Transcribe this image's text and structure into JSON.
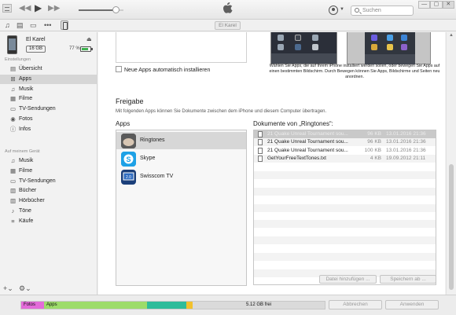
{
  "transport": {
    "prev": "◀◀",
    "play": "▶",
    "next": "▶▶",
    "volume": 0.85
  },
  "search": {
    "placeholder": "Suchen"
  },
  "window_controls": [
    "—",
    "▢",
    "✕"
  ],
  "toolbar": {
    "icons": [
      "music-note-icon",
      "film-icon",
      "tv-icon",
      "more-icon",
      "iphone-icon"
    ],
    "device_tab": "El Karel"
  },
  "device": {
    "name": "El Karel",
    "capacity": "16 GB",
    "battery_text": "77 %",
    "battery_level": 0.77
  },
  "sidebar": {
    "settings_header": "Einstellungen",
    "settings": [
      {
        "label": "Übersicht",
        "icon": "▤",
        "icon_name": "summary-icon"
      },
      {
        "label": "Apps",
        "icon": "⊞",
        "icon_name": "apps-icon"
      },
      {
        "label": "Musik",
        "icon": "♫",
        "icon_name": "music-icon"
      },
      {
        "label": "Filme",
        "icon": "▦",
        "icon_name": "film-icon"
      },
      {
        "label": "TV-Sendungen",
        "icon": "▭",
        "icon_name": "tv-icon"
      },
      {
        "label": "Fotos",
        "icon": "◉",
        "icon_name": "photos-icon"
      },
      {
        "label": "Infos",
        "icon": "ⓘ",
        "icon_name": "info-icon"
      }
    ],
    "device_header": "Auf meinem Gerät",
    "device_items": [
      {
        "label": "Musik",
        "icon": "♫",
        "icon_name": "music-icon"
      },
      {
        "label": "Filme",
        "icon": "▦",
        "icon_name": "film-icon"
      },
      {
        "label": "TV-Sendungen",
        "icon": "▭",
        "icon_name": "tv-icon"
      },
      {
        "label": "Bücher",
        "icon": "▥",
        "icon_name": "books-icon"
      },
      {
        "label": "Hörbücher",
        "icon": "▥",
        "icon_name": "audiobooks-icon"
      },
      {
        "label": "Töne",
        "icon": "♪",
        "icon_name": "tones-icon"
      },
      {
        "label": "Käufe",
        "icon": "≡",
        "icon_name": "purchases-icon"
      }
    ],
    "bottom": {
      "add": "+⌄",
      "settings": "⚙⌄"
    }
  },
  "main": {
    "auto_install_label": "Neue Apps automatisch installieren",
    "home_caption": "Wählen Sie Apps, die auf Ihrem iPhone installiert werden sollen, oder bewegen Sie Apps auf einen bestimmten Bildschirm. Durch Bewegen können Sie Apps, Bildschirme und Seiten neu anordnen.",
    "freigabe": {
      "title": "Freigabe",
      "description": "Mit folgenden Apps können Sie Dokumente zwischen dem iPhone und diesem Computer übertragen.",
      "apps_header": "Apps",
      "docs_header": "Dokumente von „Ringtones“:",
      "apps": [
        {
          "label": "Ringtones",
          "icon": "ringtones-app-icon"
        },
        {
          "label": "Skype",
          "icon": "skype-app-icon"
        },
        {
          "label": "Swisscom TV",
          "icon": "swisscom-tv-app-icon"
        }
      ],
      "documents": [
        {
          "name": "21 Quake Unreal Tournament sou...",
          "size": "96 KB",
          "date": "13.01.2016 21:36"
        },
        {
          "name": "21 Quake Unreal Tournament sou...",
          "size": "96 KB",
          "date": "13.01.2016 21:36"
        },
        {
          "name": "21 Quake Unreal Tournament sou...",
          "size": "100 KB",
          "date": "13.01.2016 21:36"
        },
        {
          "name": "GetYourFreeTextTones.txt",
          "size": "4 KB",
          "date": "19.09.2012 21:11"
        }
      ],
      "add_file_button": "Datei hinzufügen ...",
      "save_button": "Speichern ab ..."
    }
  },
  "storage": {
    "segments": [
      {
        "label": "Fotos",
        "color": "#e36bd9",
        "fraction": 0.075
      },
      {
        "label": "Apps",
        "color": "#9ddc6a",
        "fraction": 0.34
      },
      {
        "label": "",
        "color": "#2ebc9a",
        "fraction": 0.13
      },
      {
        "label": "",
        "color": "#f2c12c",
        "fraction": 0.02
      }
    ],
    "free": "5.12 GB frei"
  },
  "footer": {
    "abort": "Abbrechen",
    "apply": "Anwenden"
  }
}
